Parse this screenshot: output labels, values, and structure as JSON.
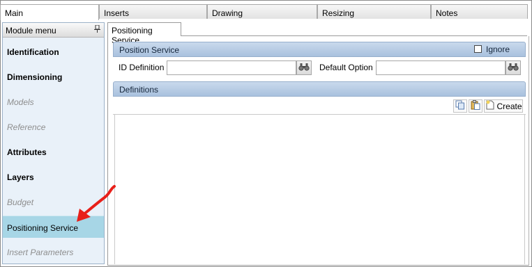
{
  "top_tabs": [
    {
      "label": "Main",
      "active": true
    },
    {
      "label": "Inserts",
      "active": false
    },
    {
      "label": "Drawing",
      "active": false
    },
    {
      "label": "Resizing",
      "active": false
    },
    {
      "label": "Notes",
      "active": false
    }
  ],
  "sidebar": {
    "title": "Module menu",
    "pin_icon": "pin-icon",
    "items": [
      {
        "label": "Identification",
        "style": "bold"
      },
      {
        "label": "Dimensioning",
        "style": "bold"
      },
      {
        "label": "Models",
        "style": "dim"
      },
      {
        "label": "Reference",
        "style": "dim"
      },
      {
        "label": "Attributes",
        "style": "bold"
      },
      {
        "label": "Layers",
        "style": "bold"
      },
      {
        "label": "Budget",
        "style": "dim"
      },
      {
        "label": "Positioning Service",
        "style": "selected"
      },
      {
        "label": "Insert Parameters",
        "style": "dim"
      }
    ]
  },
  "content_tab": {
    "label": "Positioning Service"
  },
  "position_service": {
    "title": "Position Service",
    "ignore_label": "Ignore",
    "ignore_checked": false,
    "id_definition_label": "ID Definition",
    "id_definition_value": "",
    "default_option_label": "Default Option",
    "default_option_value": ""
  },
  "definitions": {
    "title": "Definitions",
    "copy_icon": "copy-icon",
    "paste_icon": "paste-icon",
    "create_label": "Create"
  },
  "colors": {
    "panel_bar": "#b8cde6",
    "selected_item": "#a7d6e6",
    "arrow": "#e8201a"
  }
}
